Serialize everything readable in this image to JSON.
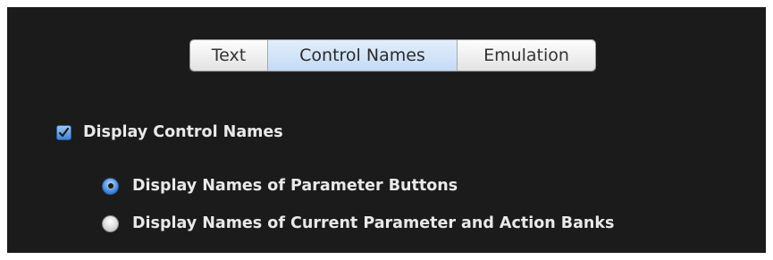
{
  "tabs": [
    {
      "label": "Text",
      "selected": false
    },
    {
      "label": "Control Names",
      "selected": true
    },
    {
      "label": "Emulation",
      "selected": false
    }
  ],
  "display_control_names": {
    "label": "Display Control Names",
    "checked": true
  },
  "radio_options": [
    {
      "label": "Display Names of Parameter Buttons",
      "selected": true
    },
    {
      "label": "Display Names of Current Parameter and Action Banks",
      "selected": false
    }
  ],
  "colors": {
    "panel_background": "#1b1b1b",
    "selected_tab": "#c3dbf6",
    "accent": "#3f82d6",
    "label_text": "#e9e9e9"
  }
}
